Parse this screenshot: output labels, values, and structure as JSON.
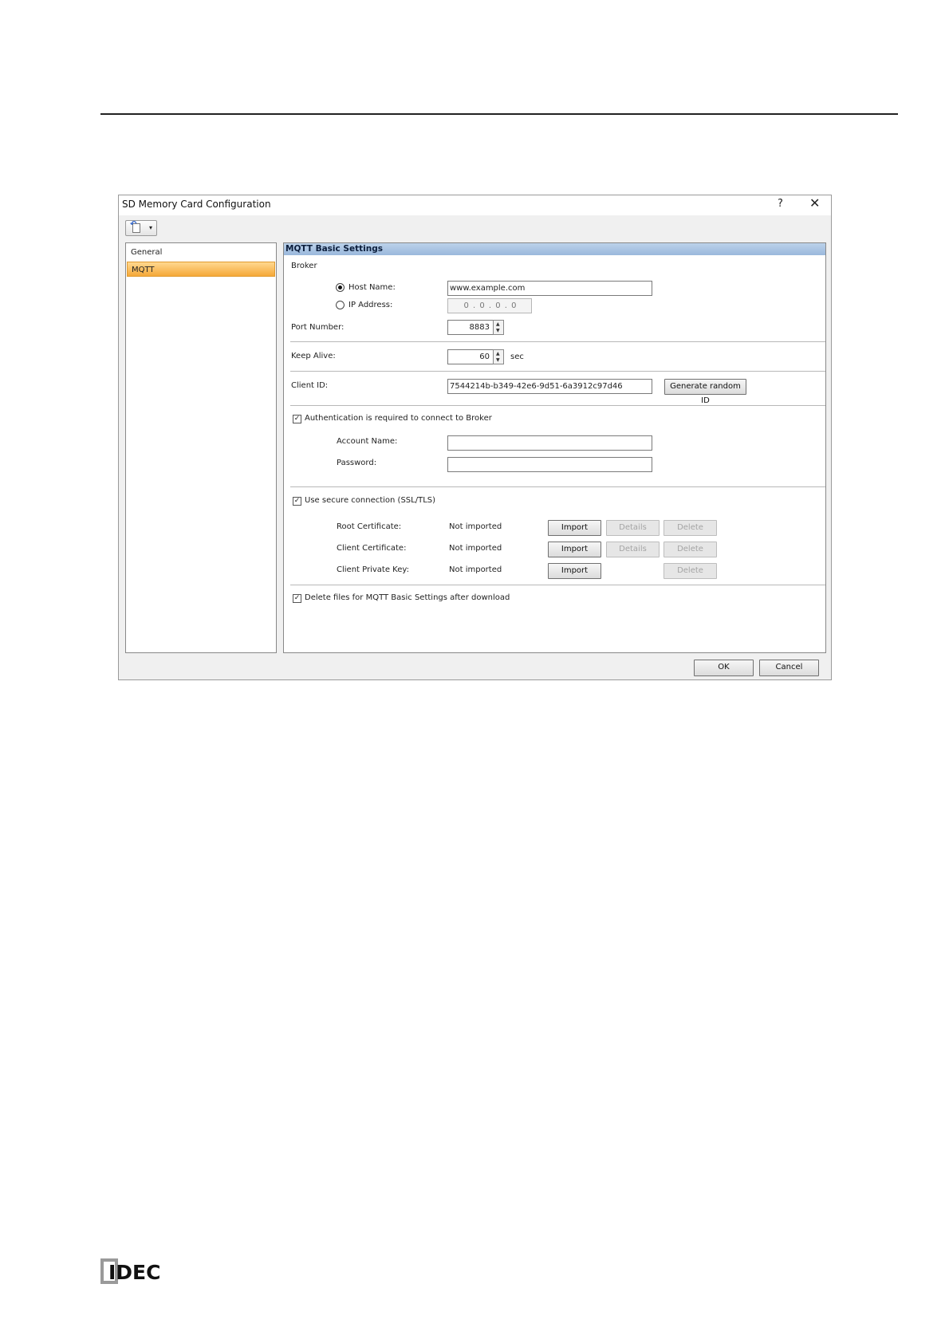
{
  "dialog": {
    "title": "SD Memory Card Configuration",
    "help_label": "?",
    "close_label": "✕"
  },
  "toolbar": {
    "dropdown_label": "▾"
  },
  "tree": {
    "items": [
      {
        "label": "General"
      },
      {
        "label": "MQTT",
        "selected": true
      }
    ]
  },
  "panel": {
    "header": "MQTT Basic Settings",
    "broker": {
      "section_label": "Broker",
      "host_name_label": "Host Name:",
      "host_name_value": "www.example.com",
      "host_name_selected": true,
      "ip_address_label": "IP Address:",
      "ip_address_value": "0 . 0 . 0 . 0"
    },
    "port_number": {
      "label": "Port Number:",
      "value": "8883"
    },
    "keep_alive": {
      "label": "Keep Alive:",
      "value": "60",
      "unit": "sec"
    },
    "client_id": {
      "label": "Client ID:",
      "value": "7544214b-b349-42e6-9d51-6a3912c97d46",
      "generate_button": "Generate random ID"
    },
    "auth": {
      "checkbox_label": "Authentication is required to connect to Broker",
      "checked": true,
      "account_name_label": "Account Name:",
      "account_name_value": "",
      "password_label": "Password:",
      "password_value": ""
    },
    "ssl": {
      "checkbox_label": "Use secure connection (SSL/TLS)",
      "checked": true,
      "rows": [
        {
          "label": "Root Certificate:",
          "status": "Not imported",
          "import": "Import",
          "details": "Details",
          "delete": "Delete"
        },
        {
          "label": "Client Certificate:",
          "status": "Not imported",
          "import": "Import",
          "details": "Details",
          "delete": "Delete"
        },
        {
          "label": "Client Private Key:",
          "status": "Not imported",
          "import": "Import",
          "delete": "Delete"
        }
      ]
    },
    "delete_files": {
      "checkbox_label": "Delete files for MQTT Basic Settings after download",
      "checked": true
    }
  },
  "footer": {
    "ok_label": "OK",
    "cancel_label": "Cancel"
  },
  "brand": {
    "logo_text": "IDEC"
  }
}
